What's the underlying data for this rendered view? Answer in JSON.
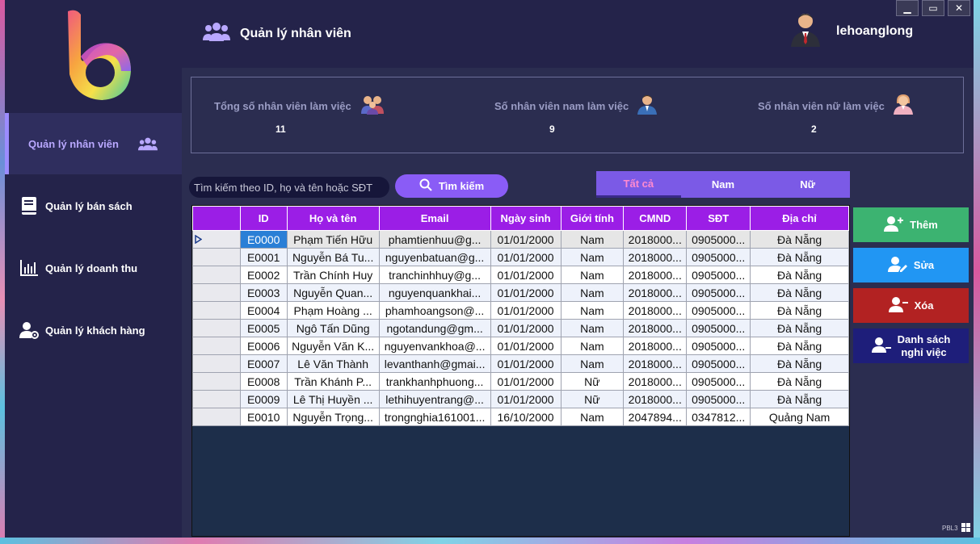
{
  "header": {
    "title": "Quản lý nhân viên",
    "username": "lehoanglong"
  },
  "window_controls": [
    "minimize",
    "maximize",
    "close"
  ],
  "sidebar": {
    "items": [
      {
        "label": "Quản lý nhân viên",
        "icon": "users-icon",
        "active": true
      },
      {
        "label": "Quản lý bán sách",
        "icon": "book-icon",
        "active": false
      },
      {
        "label": "Quản lý doanh thu",
        "icon": "bar-chart-icon",
        "active": false
      },
      {
        "label": "Quản lý khách hàng",
        "icon": "user-gear-icon",
        "active": false
      }
    ]
  },
  "stats": [
    {
      "label": "Tổng số nhân viên làm việc",
      "value": "11",
      "icon": "group-people-icon"
    },
    {
      "label": "Số nhân viên nam làm việc",
      "value": "9",
      "icon": "male-employee-icon"
    },
    {
      "label": "Số nhân viên nữ làm việc",
      "value": "2",
      "icon": "female-employee-icon"
    }
  ],
  "search": {
    "placeholder": "Tìm kiếm theo ID, họ và tên hoặc SĐT",
    "button_label": "Tìm kiếm"
  },
  "filter_tabs": [
    {
      "label": "Tất cả",
      "active": true
    },
    {
      "label": "Nam",
      "active": false
    },
    {
      "label": "Nữ",
      "active": false
    }
  ],
  "table": {
    "columns": [
      "",
      "ID",
      "Họ và tên",
      "Email",
      "Ngày sinh",
      "Giới tính",
      "CMND",
      "SĐT",
      "Địa chỉ"
    ],
    "rows": [
      [
        "E0000",
        "Phạm Tiến Hữu",
        "phamtienhuu@g...",
        "01/01/2000",
        "Nam",
        "2018000...",
        "0905000...",
        "Đà Nẵng"
      ],
      [
        "E0001",
        "Nguyễn Bá Tu...",
        "nguyenbatuan@g...",
        "01/01/2000",
        "Nam",
        "2018000...",
        "0905000...",
        "Đà Nẵng"
      ],
      [
        "E0002",
        "Trần Chính Huy",
        "tranchinhhuy@g...",
        "01/01/2000",
        "Nam",
        "2018000...",
        "0905000...",
        "Đà Nẵng"
      ],
      [
        "E0003",
        "Nguyễn Quan...",
        "nguyenquankhai...",
        "01/01/2000",
        "Nam",
        "2018000...",
        "0905000...",
        "Đà Nẵng"
      ],
      [
        "E0004",
        "Phạm Hoàng ...",
        "phamhoangson@...",
        "01/01/2000",
        "Nam",
        "2018000...",
        "0905000...",
        "Đà Nẵng"
      ],
      [
        "E0005",
        "Ngô Tấn Dũng",
        "ngotandung@gm...",
        "01/01/2000",
        "Nam",
        "2018000...",
        "0905000...",
        "Đà Nẵng"
      ],
      [
        "E0006",
        "Nguyễn Văn K...",
        "nguyenvankhoa@...",
        "01/01/2000",
        "Nam",
        "2018000...",
        "0905000...",
        "Đà Nẵng"
      ],
      [
        "E0007",
        "Lê Văn Thành",
        "levanthanh@gmai...",
        "01/01/2000",
        "Nam",
        "2018000...",
        "0905000...",
        "Đà Nẵng"
      ],
      [
        "E0008",
        "Trần Khánh P...",
        "trankhanhphuong...",
        "01/01/2000",
        "Nữ",
        "2018000...",
        "0905000...",
        "Đà Nẵng"
      ],
      [
        "E0009",
        "Lê Thị Huyền ...",
        "lethihuyentrang@...",
        "01/01/2000",
        "Nữ",
        "2018000...",
        "0905000...",
        "Đà Nẵng"
      ],
      [
        "E0010",
        "Nguyễn Trọng...",
        "trongnghia161001...",
        "16/10/2000",
        "Nam",
        "2047894...",
        "0347812...",
        "Quảng Nam"
      ]
    ],
    "selected_row": 0
  },
  "actions": {
    "add": "Thêm",
    "edit": "Sửa",
    "delete": "Xóa",
    "list_line1": "Danh sách",
    "list_line2": "nghỉ việc"
  },
  "footer": {
    "tag": "PBL3"
  },
  "colors": {
    "sidebar_bg": "#24234a",
    "accent_purple": "#8a5cf6",
    "table_header": "#9b1ee6",
    "add_green": "#3cb371",
    "edit_blue": "#2196f3",
    "delete_red": "#b22222",
    "list_navy": "#1e1e7a",
    "active_tab_text": "#ff8ad0"
  }
}
